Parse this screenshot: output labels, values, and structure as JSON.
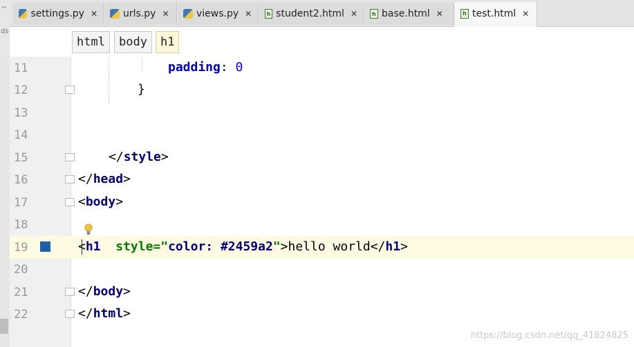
{
  "tabs": [
    {
      "label": "settings.py",
      "icon": "python-file-icon",
      "active": false
    },
    {
      "label": "urls.py",
      "icon": "python-file-icon",
      "active": false
    },
    {
      "label": "views.py",
      "icon": "python-file-icon",
      "active": false
    },
    {
      "label": "student2.html",
      "icon": "html-file-icon",
      "active": false
    },
    {
      "label": "base.html",
      "icon": "html-file-icon",
      "active": false
    },
    {
      "label": "test.html",
      "icon": "html-file-icon",
      "active": true
    }
  ],
  "breadcrumbs": [
    "html",
    "body",
    "h1"
  ],
  "line_numbers": [
    "11",
    "12",
    "13",
    "14",
    "15",
    "16",
    "17",
    "18",
    "19",
    "20",
    "21",
    "22"
  ],
  "code": {
    "l11_prop": "padding",
    "l11_colon": ": ",
    "l11_val": "0",
    "l12": "}",
    "l15_open": "</",
    "l15_tag": "style",
    "l15_close": ">",
    "l16_open": "</",
    "l16_tag": "head",
    "l16_close": ">",
    "l17_open": "<",
    "l17_tag": "body",
    "l17_close": ">",
    "l19_open": "<",
    "l19_tag": "h1",
    "l19_attr": "style=",
    "l19_q1": "\"",
    "l19_val": "color: #2459a2",
    "l19_q2": "\"",
    "l19_gt": ">",
    "l19_text": "hello world",
    "l19_end_open": "</",
    "l19_end_tag": "h1",
    "l19_end_close": ">",
    "l21_open": "</",
    "l21_tag": "body",
    "l21_close": ">",
    "l22_open": "</",
    "l22_tag": "html",
    "l22_close": ">"
  },
  "watermark": "https://blog.csdn.net/qq_41824825",
  "colors": {
    "bookmark": "#1f5fa8",
    "current_line": "#fffae2",
    "tag": "#000080",
    "string": "#008000"
  }
}
